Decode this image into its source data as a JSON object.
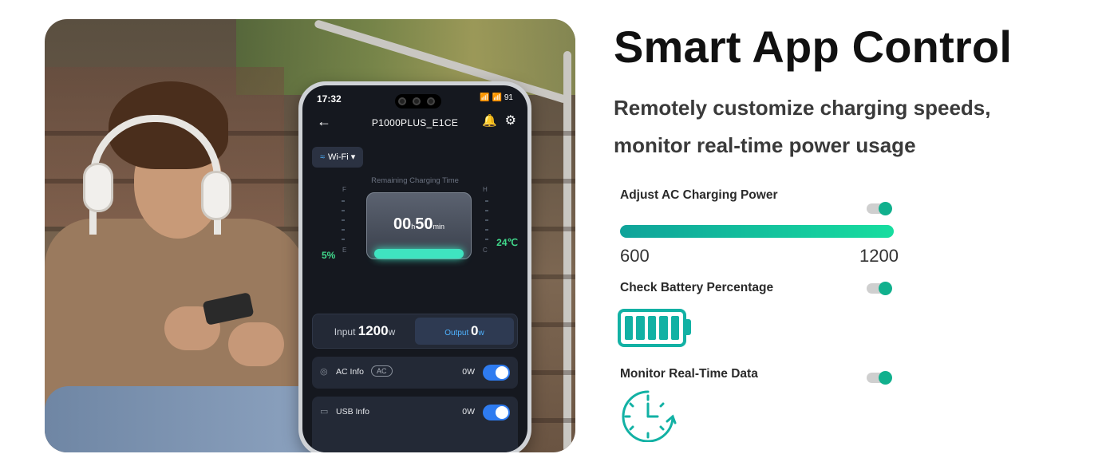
{
  "phone": {
    "time": "17:32",
    "status_icons": "📶 📶 91",
    "device_name": "P1000PLUS_E1CE",
    "wifi_label": "Wi-Fi",
    "remaining_label": "Remaining Charging Time",
    "timer_hours": "00",
    "timer_h_unit": "h",
    "timer_minutes": "50",
    "timer_min_unit": "min",
    "battery_pct": "5%",
    "temperature": "24℃",
    "gauge_f": "F",
    "gauge_e": "E",
    "gauge_h": "H",
    "gauge_c": "C",
    "input_label": "Input",
    "input_value": "1200",
    "input_unit": "w",
    "output_label": "Output",
    "output_value": "0",
    "output_unit": "w",
    "ac_info_label": "AC Info",
    "ac_badge": "AC",
    "ac_value": "0W",
    "usb_info_label": "USB Info",
    "usb_value": "0W"
  },
  "content": {
    "title": "Smart App Control",
    "subtitle_line1": "Remotely customize charging speeds,",
    "subtitle_line2": "monitor real-time power usage",
    "features": {
      "ac_power": {
        "label": "Adjust AC Charging Power",
        "min": "600",
        "max": "1200",
        "enabled": true
      },
      "battery": {
        "label": "Check Battery Percentage",
        "enabled": true,
        "cells": 5
      },
      "realtime": {
        "label": "Monitor Real-Time Data",
        "enabled": true
      }
    }
  },
  "colors": {
    "accent": "#11b08d",
    "teal": "#12b1a4",
    "phone_switch": "#2e7bf0",
    "phone_green": "#41d98c"
  }
}
